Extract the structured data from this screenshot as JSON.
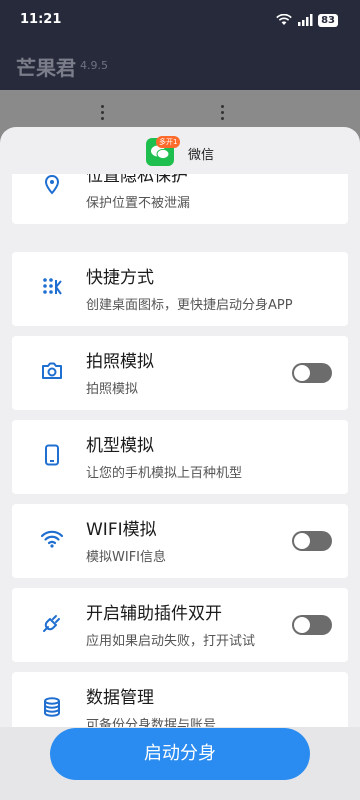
{
  "status_bar": {
    "time": "11:21",
    "network": "5G",
    "battery": "83"
  },
  "header": {
    "title": "芒果君",
    "version": "4.9.5"
  },
  "sheet": {
    "app_name": "微信",
    "badge": "多开1",
    "items": [
      {
        "title": "位置隐私保护",
        "subtitle": "保护位置不被泄漏",
        "icon": "location-pin-icon",
        "has_toggle": false
      },
      {
        "title": "快捷方式",
        "subtitle": "创建桌面图标，更快捷启动分身APP",
        "icon": "shortcut-grid-icon",
        "has_toggle": false
      },
      {
        "title": "拍照模拟",
        "subtitle": "拍照模拟",
        "icon": "camera-icon",
        "has_toggle": true,
        "toggle_on": false
      },
      {
        "title": "机型模拟",
        "subtitle": "让您的手机模拟上百种机型",
        "icon": "phone-icon",
        "has_toggle": false
      },
      {
        "title": "WIFI模拟",
        "subtitle": "模拟WIFI信息",
        "icon": "wifi-icon",
        "has_toggle": true,
        "toggle_on": false
      },
      {
        "title": "开启辅助插件双开",
        "subtitle": "应用如果启动失败，打开试试",
        "icon": "plug-icon",
        "has_toggle": true,
        "toggle_on": false
      },
      {
        "title": "数据管理",
        "subtitle": "可备份分身数据与账号",
        "icon": "database-icon",
        "has_toggle": false
      }
    ]
  },
  "start_button_label": "启动分身",
  "colors": {
    "accent": "#2a8cf0",
    "icon": "#1f6fd1",
    "toggle_off": "#6c6c6c"
  }
}
